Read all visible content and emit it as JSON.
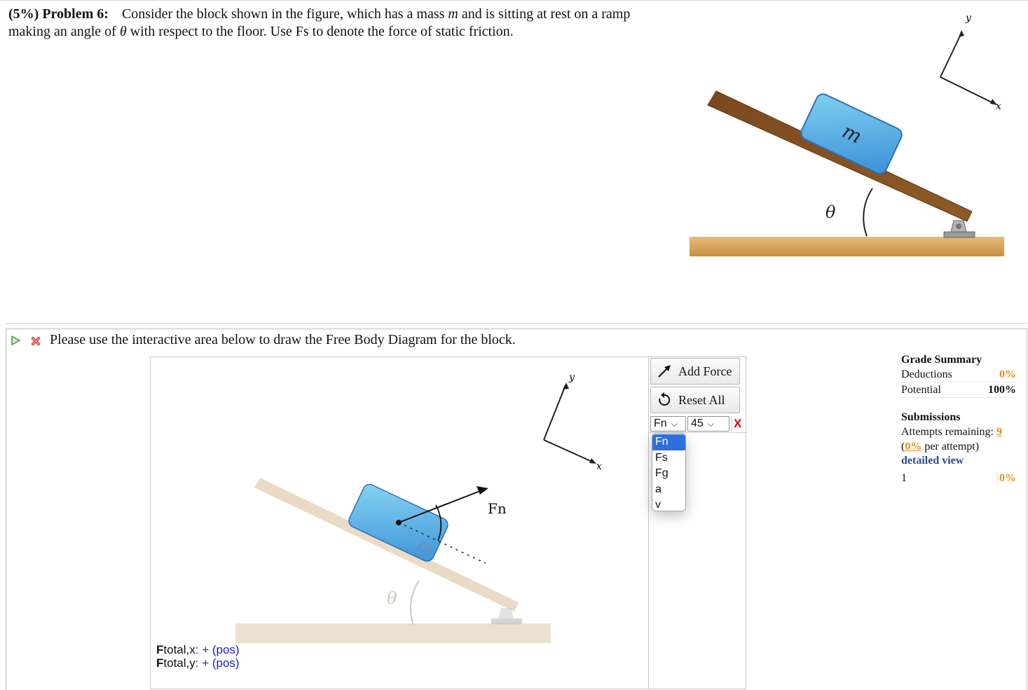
{
  "problem": {
    "heading": "(5%) Problem 6:",
    "text_1": "Consider the block shown in the figure, which has a mass",
    "mass_symbol": "m",
    "text_2": "and is sitting at rest on a ramp making an angle of",
    "angle_symbol": "θ",
    "text_3": "with respect to the floor. Use Fs to denote the force of static friction."
  },
  "figure": {
    "block_label": "m",
    "angle_label": "θ",
    "axis_y": "y",
    "axis_x": "x"
  },
  "part": {
    "instruction": "Please use the interactive area below to draw the Free Body Diagram for the block."
  },
  "fbd": {
    "block_label": "m",
    "angle_label": "θ",
    "axis_y": "y",
    "axis_x": "x",
    "force_label": "Fn",
    "force_angle_deg": 45
  },
  "tools": {
    "add_force": "Add Force",
    "reset_all": "Reset All",
    "selected_force": "Fn",
    "selected_angle": "45",
    "delete": "X",
    "force_options": [
      "Fn",
      "Fs",
      "Fg",
      "a",
      "v"
    ]
  },
  "totals": {
    "x_F": "F",
    "x_sub": "total,x",
    "x_value": ": + (pos)",
    "y_F": "F",
    "y_sub": "total,y",
    "y_value": ": + (pos)"
  },
  "grade": {
    "title": "Grade Summary",
    "deductions_label": "Deductions",
    "deductions_value": "0%",
    "potential_label": "Potential",
    "potential_value": "100%",
    "submissions_title": "Submissions",
    "attempts_label": "Attempts remaining:",
    "attempts_value": "9",
    "per_attempt_pct": "0%",
    "per_attempt_text": "per attempt)",
    "per_attempt_open": "(",
    "detailed_view": "detailed view",
    "history_index": "1",
    "history_pct": "0%"
  }
}
